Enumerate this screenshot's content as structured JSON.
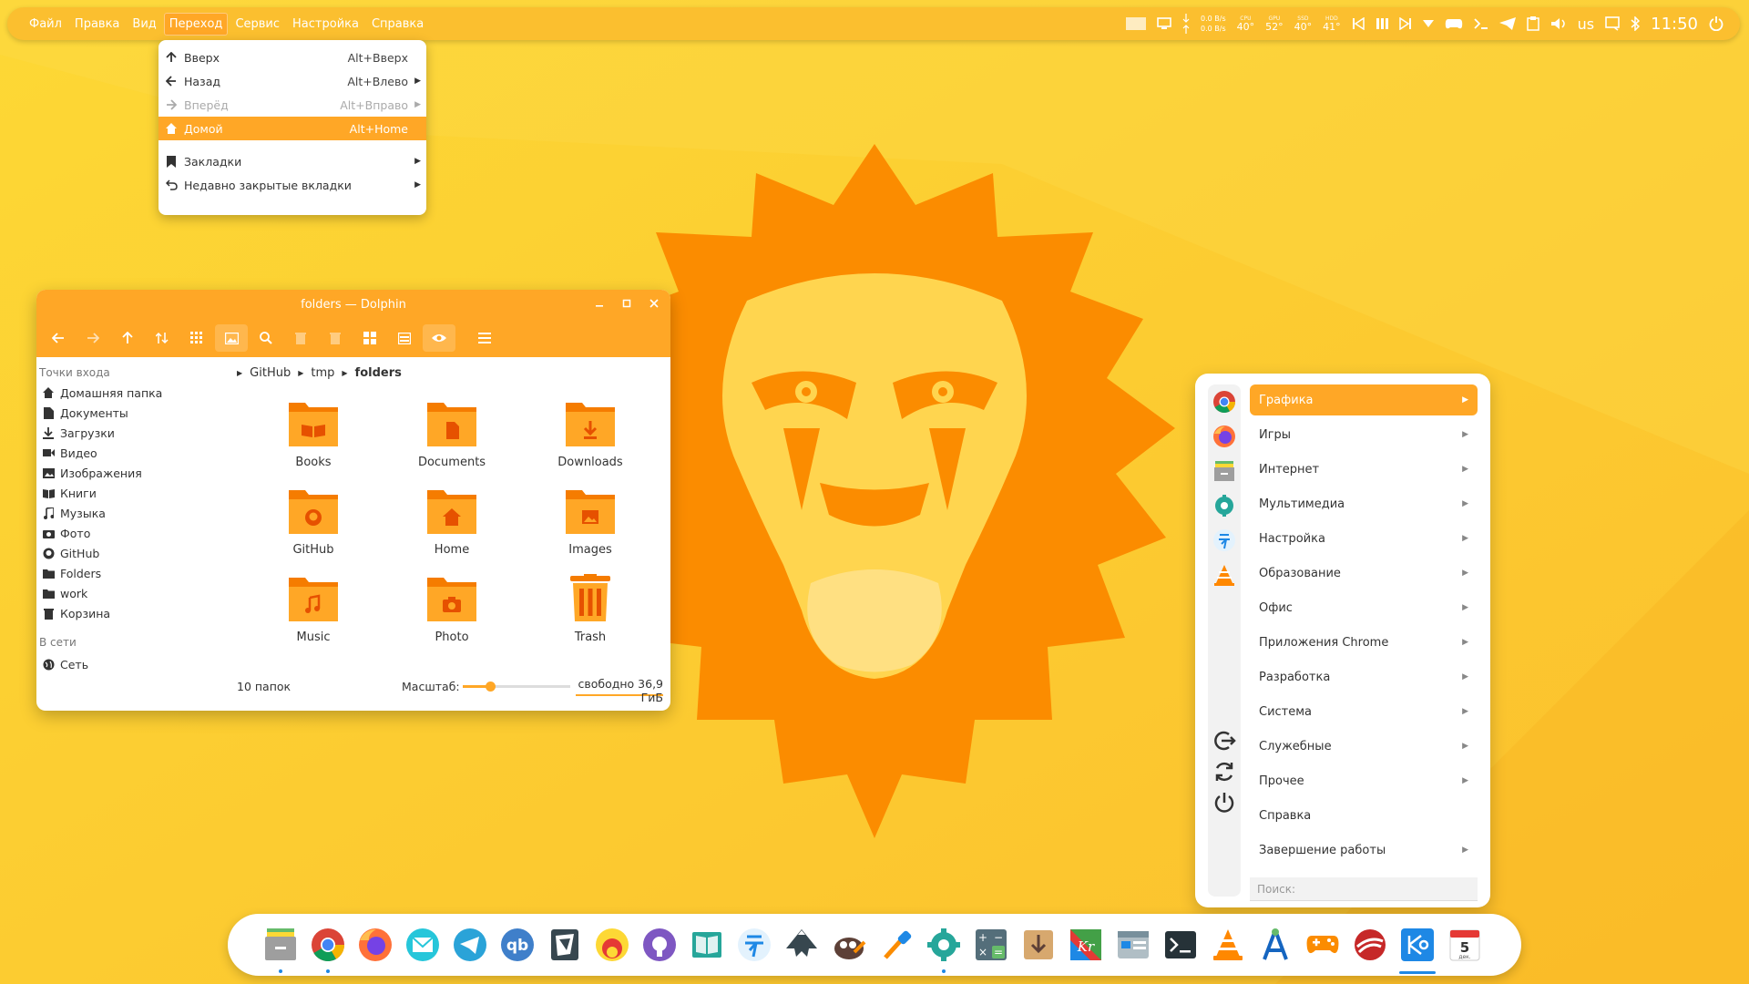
{
  "top_panel": {
    "menu": [
      "Файл",
      "Правка",
      "Вид",
      "Переход",
      "Сервис",
      "Настройка",
      "Справка"
    ],
    "net_down": "0.0 B/s",
    "net_up": "0.0 B/s",
    "sensors": [
      {
        "label": "CPU",
        "value": "40°"
      },
      {
        "label": "GPU",
        "value": "52°"
      },
      {
        "label": "SSD",
        "value": "40°"
      },
      {
        "label": "HDD",
        "value": "41°"
      }
    ],
    "keyboard_layout": "us",
    "clock": "11:50"
  },
  "go_menu": {
    "items": [
      {
        "icon": "arrow-up-icon",
        "label": "Вверх",
        "shortcut": "Alt+Вверх"
      },
      {
        "icon": "arrow-left-icon",
        "label": "Назад",
        "shortcut": "Alt+Влево"
      },
      {
        "icon": "arrow-right-icon",
        "label": "Вперёд",
        "shortcut": "Alt+Вправо"
      },
      {
        "icon": "home-icon",
        "label": "Домой",
        "shortcut": "Alt+Home"
      },
      {
        "icon": "bookmark-icon",
        "label": "Закладки",
        "shortcut": ""
      },
      {
        "icon": "undo-icon",
        "label": "Недавно закрытые вкладки",
        "shortcut": ""
      }
    ]
  },
  "dolphin": {
    "title": "folders — Dolphin",
    "places_header": "Точки входа",
    "places": [
      "Домашняя папка",
      "Документы",
      "Загрузки",
      "Видео",
      "Изображения",
      "Книги",
      "Музыка",
      "Фото",
      "GitHub",
      "Folders",
      "work",
      "Корзина"
    ],
    "network_header": "В сети",
    "network": [
      "Сеть"
    ],
    "breadcrumb": [
      "GitHub",
      "tmp",
      "folders"
    ],
    "files": [
      "Books",
      "Documents",
      "Downloads",
      "GitHub",
      "Home",
      "Images",
      "Music",
      "Photo",
      "Trash"
    ],
    "status_count": "10 папок",
    "zoom_label": "Масштаб:",
    "zoom_level": 0.25,
    "free_space": "свободно 36,9 ГиБ"
  },
  "app_menu": {
    "categories": [
      "Графика",
      "Игры",
      "Интернет",
      "Мультимедиа",
      "Настройка",
      "Образование",
      "Офис",
      "Приложения Chrome",
      "Разработка",
      "Система",
      "Служебные",
      "Прочее",
      "Справка",
      "Завершение работы"
    ],
    "search_placeholder": "Поиск:"
  },
  "dock": {
    "apps": [
      "file-manager-icon",
      "chrome-icon",
      "firefox-icon",
      "mail-icon",
      "telegram-icon",
      "qbittorrent-icon",
      "libreoffice-icon",
      "gnome-web-icon",
      "github-icon",
      "book-reader-icon",
      "kdeconnect-icon",
      "inkscape-icon",
      "gimp-icon",
      "color-picker-icon",
      "settings-icon",
      "calculator-icon",
      "archive-icon",
      "krita-icon",
      "dolphin-icon",
      "terminal-icon",
      "vlc-icon",
      "android-studio-icon",
      "games-icon",
      "tutanota-icon",
      "kde-icon",
      "calendar-icon"
    ],
    "calendar_day": "5",
    "calendar_month": "дек."
  },
  "colors": {
    "accent": "#ffa726",
    "wallpaper": "#fbc02d",
    "lion_mane": "#fb8c00",
    "lion_face": "#ffd54f"
  }
}
